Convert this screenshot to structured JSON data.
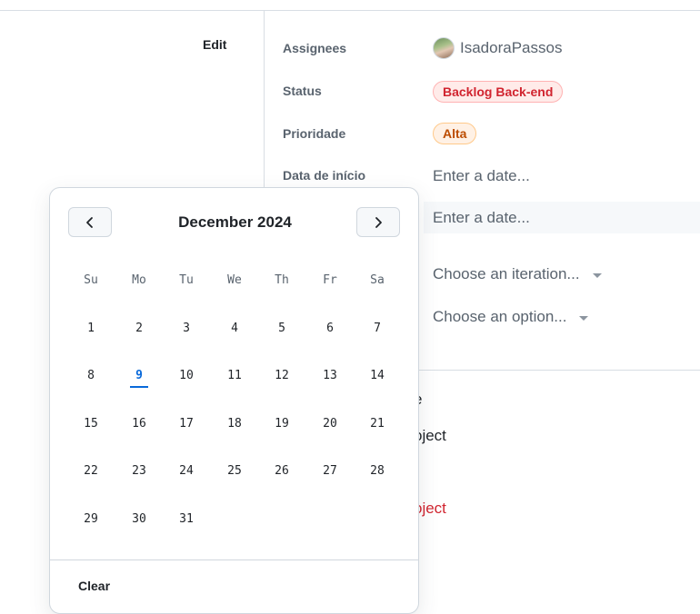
{
  "sidebar": {
    "edit_label": "Edit"
  },
  "fields": {
    "assignees_label": "Assignees",
    "assignee_name": "IsadoraPassos",
    "status_label": "Status",
    "status_value": "Backlog Back-end",
    "priority_label": "Prioridade",
    "priority_value": "Alta",
    "start_date_label": "Data de início",
    "start_date_placeholder": "Enter a date...",
    "end_date_placeholder": "Enter a date...",
    "iteration_placeholder": "Choose an iteration...",
    "option_placeholder": "Choose an option..."
  },
  "background": {
    "fragment_1": "e",
    "fragment_2": "oject",
    "fragment_3": "oject"
  },
  "calendar": {
    "month_title": "December 2024",
    "weekdays": [
      "Su",
      "Mo",
      "Tu",
      "We",
      "Th",
      "Fr",
      "Sa"
    ],
    "weeks": [
      [
        "1",
        "2",
        "3",
        "4",
        "5",
        "6",
        "7"
      ],
      [
        "8",
        "9",
        "10",
        "11",
        "12",
        "13",
        "14"
      ],
      [
        "15",
        "16",
        "17",
        "18",
        "19",
        "20",
        "21"
      ],
      [
        "22",
        "23",
        "24",
        "25",
        "26",
        "27",
        "28"
      ],
      [
        "29",
        "30",
        "31",
        "",
        "",
        "",
        ""
      ]
    ],
    "today": "9",
    "clear_label": "Clear"
  },
  "colors": {
    "status_text": "#d1242f",
    "priority_text": "#bc4c00",
    "today_accent": "#0969da"
  },
  "icons": {
    "prev": "chevron-left-icon",
    "next": "chevron-right-icon",
    "dropdown": "triangle-down-icon"
  }
}
